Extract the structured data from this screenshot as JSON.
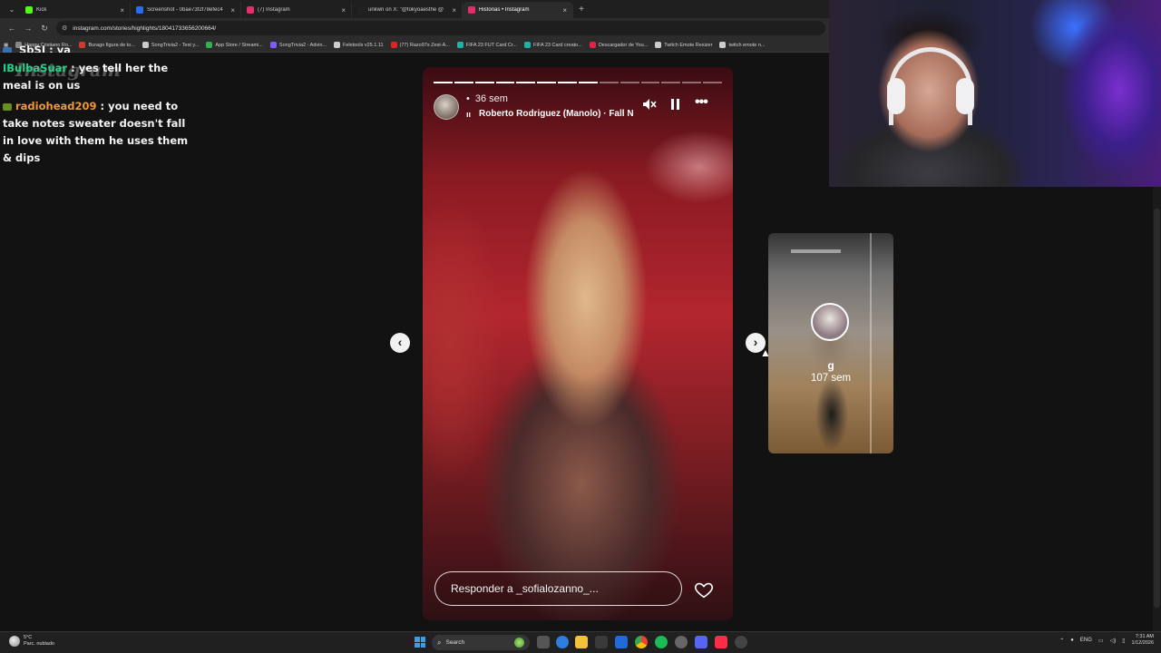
{
  "browser": {
    "tabs": [
      {
        "title": "Kick",
        "color": "#53fc18",
        "active": false
      },
      {
        "title": "Screenshot - 0bae73f2f78efec4",
        "color": "#2b6cf0",
        "active": false
      },
      {
        "title": "(7) Instagram",
        "color": "#e1306c",
        "active": false
      },
      {
        "title": "unkwn on X: \"@tokyoaesthe @",
        "color": "#222222",
        "active": false
      },
      {
        "title": "Historias • Instagram",
        "color": "#e1306c",
        "active": true
      }
    ],
    "address": "instagram.com/stories/highlights/18041733656200664/",
    "bookmarks": [
      {
        "label": "Happy Cristiano Ro...",
        "color": "#888888"
      },
      {
        "label": "Burago figura de to...",
        "color": "#d33a2c"
      },
      {
        "label": "SongTrivia2 - Test y...",
        "color": "#cccccc"
      },
      {
        "label": "App Store / Streami...",
        "color": "#2fb34a"
      },
      {
        "label": "SongTrivia2 - Advin...",
        "color": "#7c5cff"
      },
      {
        "label": "Feletools v25.1.11",
        "color": "#cccccc"
      },
      {
        "label": "(77) Razo97s Zest-A...",
        "color": "#e02424"
      },
      {
        "label": "FIFA 23 FUT Card Cr...",
        "color": "#1fb3a6"
      },
      {
        "label": "FIFA 23 Card creato...",
        "color": "#1fb3a6"
      },
      {
        "label": "Descargador de You...",
        "color": "#e02448"
      },
      {
        "label": "Twitch Emote Resizer",
        "color": "#cccccc"
      },
      {
        "label": "twitch emote n...",
        "color": "#cccccc"
      }
    ]
  },
  "chat": {
    "partial_line": "SbSI : ya",
    "messages": [
      {
        "user": "IBulbaSuar",
        "text": ": yes tell her the meal is on us",
        "user_color": "#22d38a"
      },
      {
        "user": "radiohead209",
        "text": ": you need to take notes sweater doesn't fall in love with them he uses them & dips",
        "user_color": "#f09a2b"
      }
    ],
    "watermark": "Instagram"
  },
  "story": {
    "progress": {
      "segments": 14,
      "completed": 8
    },
    "time": "36 sem",
    "music": "Roberto Rodriguez (Manolo) · Fall N",
    "music_icon": "music-bars-icon",
    "reply_placeholder": "Responder a _sofialozanno_..."
  },
  "next_story": {
    "name": "g",
    "time": "107 sem"
  },
  "taskbar": {
    "weather_temp": "5°C",
    "weather_desc": "Parc. nublado",
    "search_label": "Search",
    "language": "ENG",
    "time": "7:31 AM",
    "date": "1/12/2026"
  }
}
